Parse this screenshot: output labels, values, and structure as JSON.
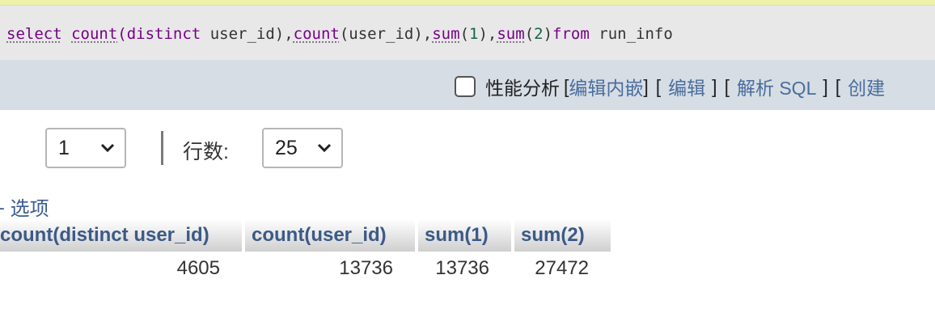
{
  "sql": {
    "tokens": [
      {
        "t": "select",
        "c": "kw"
      },
      {
        "t": " ",
        "c": "plain"
      },
      {
        "t": "count",
        "c": "fn"
      },
      {
        "t": "(distinct",
        "c": "kw-paren"
      },
      {
        "t": " user_id),",
        "c": "plain"
      },
      {
        "t": "count",
        "c": "fn"
      },
      {
        "t": "(user_id),",
        "c": "plain"
      },
      {
        "t": "sum",
        "c": "fn"
      },
      {
        "t": "(",
        "c": "plain"
      },
      {
        "t": "1",
        "c": "num"
      },
      {
        "t": "),",
        "c": "plain"
      },
      {
        "t": "sum",
        "c": "fn"
      },
      {
        "t": "(",
        "c": "plain"
      },
      {
        "t": "2",
        "c": "num"
      },
      {
        "t": ")",
        "c": "plain"
      },
      {
        "t": "from",
        "c": "kw2"
      },
      {
        "t": " run_info",
        "c": "plain"
      }
    ]
  },
  "toolbar": {
    "profiling_label": "性能分析",
    "open_bracket": "[",
    "close_bracket": "]",
    "edit_inline": "编辑内嵌",
    "edit": "编辑",
    "explain_sql": "解析 SQL",
    "create_partial": "创建"
  },
  "pager": {
    "page_value": "1",
    "rows_label": "行数:",
    "rows_value": "25"
  },
  "options_label": "+ 选项",
  "table": {
    "columns": [
      "count(distinct user_id)",
      "count(user_id)",
      "sum(1)",
      "sum(2)"
    ],
    "rows": [
      [
        "4605",
        "13736",
        "13736",
        "27472"
      ]
    ]
  }
}
